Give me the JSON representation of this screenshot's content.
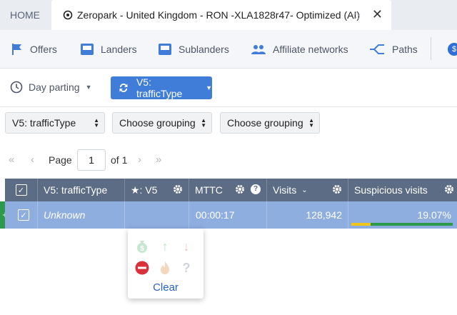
{
  "tabs": {
    "home_label": "HOME",
    "active_title": "Zeropark - United Kingdom - RON -XLA1828r47- Optimized (AI)"
  },
  "nav": {
    "items": [
      "Offers",
      "Landers",
      "Sublanders",
      "Affiliate networks",
      "Paths"
    ]
  },
  "toolbar": {
    "day_parting": "Day parting",
    "traffic_type_button": "V5: trafficType"
  },
  "groupings": [
    "V5: trafficType",
    "Choose grouping",
    "Choose grouping"
  ],
  "pager": {
    "page_label": "Page",
    "current_page": "1",
    "of_label": "of 1"
  },
  "table": {
    "headers": [
      "V5: trafficType",
      "★: V5",
      "MTTC",
      "Visits",
      "Suspicious visits"
    ],
    "row": {
      "traffic_type": "Unknown",
      "v5": "",
      "mttc": "00:00:17",
      "visits": "128,942",
      "suspicious_visits": "19.07%"
    },
    "suspicious_fraction": 0.19
  },
  "popup": {
    "icons": [
      "money-bag-icon",
      "arrow-up-icon",
      "arrow-down-icon",
      "stop-icon",
      "fire-icon",
      "question-icon"
    ],
    "clear_label": "Clear"
  },
  "colors": {
    "accent": "#3f7dd9",
    "table_header": "#5c6c84",
    "row_selected": "#8eaee0",
    "positive": "#2c9a4a",
    "warning": "#f0c419",
    "danger": "#d9303b"
  }
}
